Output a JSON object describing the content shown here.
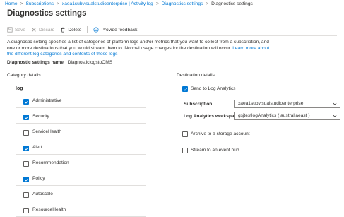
{
  "breadcrumb": [
    "Home",
    "Subscriptions",
    "xaea1subvisualstudioenterprise | Activity log",
    "Diagnostics settings",
    "Diagnostics settings"
  ],
  "page_title": "Diagnostics settings",
  "toolbar": {
    "save": "Save",
    "discard": "Discard",
    "delete": "Delete",
    "feedback": "Provide feedback"
  },
  "description": {
    "text": "A diagnostic setting specifies a list of categories of platform logs and/or metrics that you want to collect from a subscription, and one or more destinations that you would stream them to. Normal usage charges for the destination will occur. ",
    "link": "Learn more about the different log categories and contents of those logs"
  },
  "setting_name": {
    "label": "Diagnostic settings name",
    "value": "DiagnosticlogstoOMS"
  },
  "category_details": {
    "heading": "Category details",
    "log_heading": "log",
    "items": [
      {
        "label": "Administrative",
        "checked": true
      },
      {
        "label": "Security",
        "checked": true
      },
      {
        "label": "ServiceHealth",
        "checked": false
      },
      {
        "label": "Alert",
        "checked": true
      },
      {
        "label": "Recommendation",
        "checked": false
      },
      {
        "label": "Policy",
        "checked": true
      },
      {
        "label": "Autoscale",
        "checked": false
      },
      {
        "label": "ResourceHealth",
        "checked": false
      }
    ]
  },
  "destination_details": {
    "heading": "Destination details",
    "send_to_log_analytics": {
      "label": "Send to Log Analytics",
      "checked": true
    },
    "subscription": {
      "label": "Subscription",
      "value": "xaea1subvisualstudioenterprise"
    },
    "workspace": {
      "label": "Log Analytics workspace",
      "value": "gsjtestlogAnalytics ( australiaeast )"
    },
    "archive": {
      "label": "Archive to a storage account",
      "checked": false
    },
    "stream": {
      "label": "Stream to an event hub",
      "checked": false
    }
  },
  "colors": {
    "accent": "#0078d4",
    "text": "#323130",
    "divider": "#e1dfdd"
  }
}
